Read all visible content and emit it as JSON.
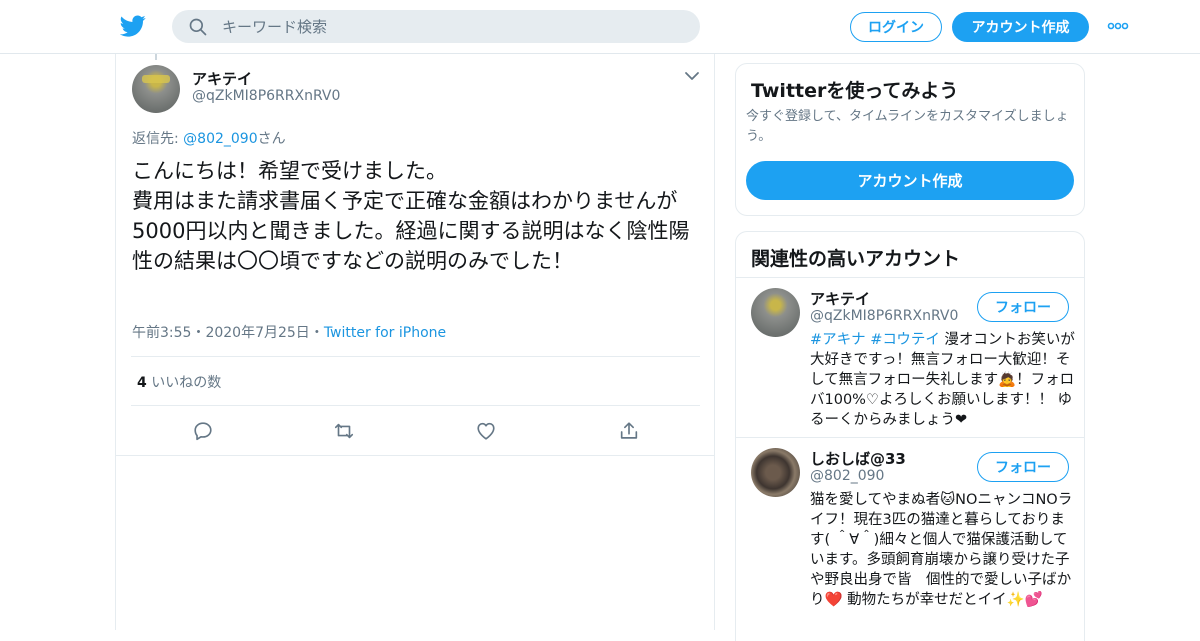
{
  "header": {
    "search_placeholder": "キーワード検索",
    "login_label": "ログイン",
    "signup_label": "アカウント作成",
    "brand_color": "#1da1f2",
    "icons": [
      "twitter-bird-icon",
      "search-icon",
      "more-dots-icon"
    ]
  },
  "tweet": {
    "author_name": "アキテイ",
    "author_handle": "@qZkMI8P6RRXnRV0",
    "reply_prefix": "返信先: ",
    "reply_mention": "@802_090",
    "reply_suffix": "さん",
    "text": "こんにちは！希望で受けました。\n費用はまた請求書届く予定で正確な金額はわかりませんが5000円以内と聞きました。経過に関する説明はなく陰性陽性の結果は〇〇頃ですなどの説明のみでした！",
    "time": "午前3:55",
    "sep1": "・",
    "date": "2020年7月25日",
    "sep2": "・",
    "via": "Twitter for iPhone",
    "likes_count": "4",
    "likes_label": " いいねの数",
    "actions": [
      "reply-icon",
      "retweet-icon",
      "like-icon",
      "share-icon"
    ]
  },
  "signup_card": {
    "title": "Twitterを使ってみよう",
    "desc": "今すぐ登録して、タイムラインをカスタマイズしましょう。",
    "cta": "アカウント作成"
  },
  "related": {
    "title": "関連性の高いアカウント",
    "accounts": [
      {
        "name": "アキテイ",
        "handle": "@qZkMI8P6RRXnRV0",
        "follow": "フォロー",
        "tags": "#アキナ #コウテイ",
        "bio": " 漫オコントお笑いが大好きですっ！無言フォロー大歓迎！そして無言フォロー失礼します🙇！フォロバ100%♡よろしくお願いします！！ ゆるーくからみましょう❤"
      },
      {
        "name": "しおしば@33",
        "handle": "@802_090",
        "follow": "フォロー",
        "bio": "猫を愛してやまぬ者🐱NOニャンコNOライフ！現在3匹の猫達と暮らしております( ＾∀＾)細々と個人で猫保護活動しています。多頭飼育崩壊から譲り受けた子や野良出身で皆　個性的で愛しい子ばかり❤️ 動物たちが幸せだとイイ✨💕"
      }
    ]
  }
}
